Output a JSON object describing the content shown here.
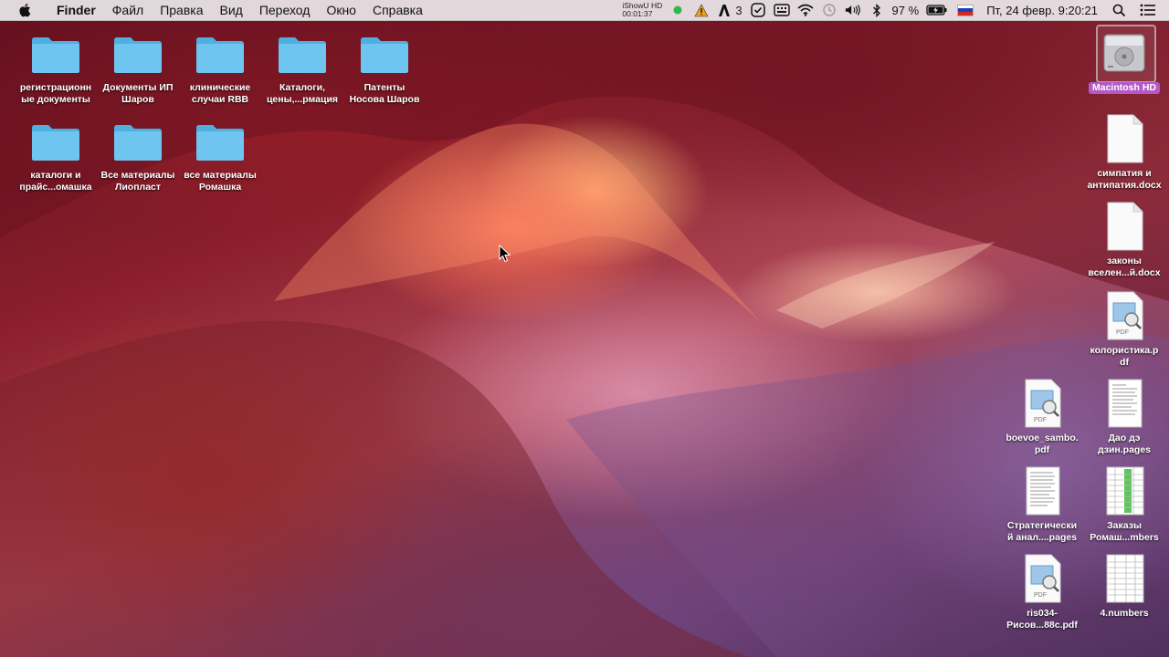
{
  "menubar": {
    "apple_icon": "apple-logo-icon",
    "app_name": "Finder",
    "items": [
      "Файл",
      "Правка",
      "Вид",
      "Переход",
      "Окно",
      "Справка"
    ],
    "recorder_name": "iShowU HD",
    "recorder_time": "00:01:37",
    "badge_count": "3",
    "battery_percent": "97 %",
    "datetime": "Пт, 24 февр.  9:20:21"
  },
  "desktop": {
    "folders": [
      {
        "label": "регистрационн\nые документы"
      },
      {
        "label": "Документы ИП\nШаров"
      },
      {
        "label": "клинические\nслучаи RBB"
      },
      {
        "label": "Каталоги,\nцены,...рмация"
      },
      {
        "label": "Патенты\nНосова Шаров"
      },
      {
        "label": "каталоги и\nпрайс...омашка"
      },
      {
        "label": "Все материалы\nЛиопласт"
      },
      {
        "label": "все материалы\nРомашка"
      }
    ],
    "drive": {
      "label": "Macintosh HD"
    },
    "files": [
      {
        "label": "симпатия и\nантипатия.docx",
        "type": "docx"
      },
      {
        "label": "законы\nвселен...й.docx",
        "type": "docx"
      },
      {
        "label": "колористика.p\ndf",
        "type": "pdf"
      },
      {
        "label": "boevoe_sambo.\npdf",
        "type": "pdf"
      },
      {
        "label": "Дао дэ\nдзин.pages",
        "type": "pages"
      },
      {
        "label": "Стратегически\nй анал....pages",
        "type": "pages"
      },
      {
        "label": "Заказы\nРомаш...mbers",
        "type": "numbers"
      },
      {
        "label": "ris034-\nРисов...88c.pdf",
        "type": "pdf"
      },
      {
        "label": "4.numbers",
        "type": "numbers"
      }
    ],
    "pdf_tag": "PDF"
  },
  "colors": {
    "folder": "#6ec6f0",
    "folder_dark": "#4fb0e0",
    "selection": "#b45ac8"
  }
}
